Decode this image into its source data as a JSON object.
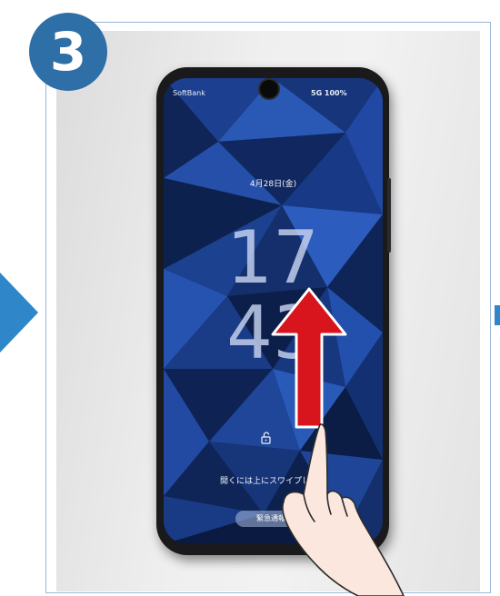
{
  "step": {
    "number": "3"
  },
  "status_bar": {
    "carrier": "SoftBank",
    "right": "5G 100%"
  },
  "lock_screen": {
    "date": "4月28日(金)",
    "clock_hour": "17",
    "clock_minute": "43",
    "swipe_hint": "開くには上にスワイプします",
    "emergency_label": "緊急通報"
  },
  "icons": {
    "badge": "step-number-badge",
    "arrows": "navigation-arrow-icon",
    "gesture": "swipe-up-arrow-icon",
    "hand": "finger-hand-icon",
    "lock": "unlock-icon"
  },
  "colors": {
    "badge": "#2e6fa7",
    "side_arrow": "#2f86c9",
    "swipe_arrow": "#d8141d",
    "wallpaper": "#12306e"
  }
}
